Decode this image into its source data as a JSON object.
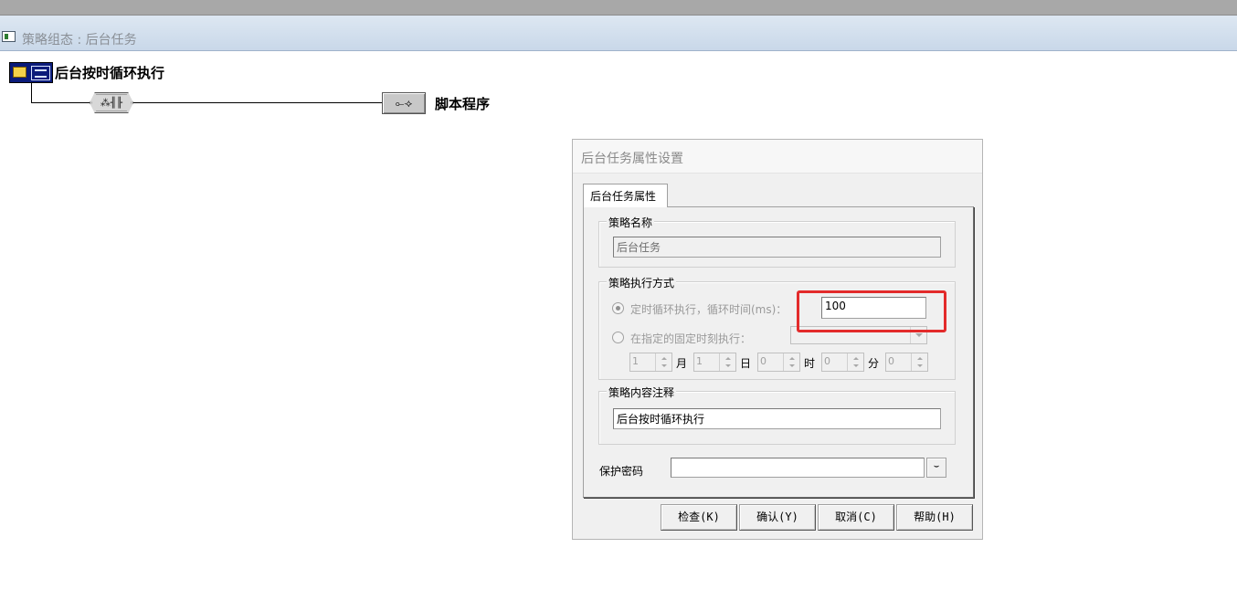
{
  "window": {
    "title": "策略组态 : 后台任务"
  },
  "tree": {
    "root_label": "后台按时循环执行",
    "condition_text": "⁂╢╟",
    "script_label": "脚本程序"
  },
  "dialog": {
    "title": "后台任务属性设置",
    "tab_label": "后台任务属性",
    "name_group": {
      "legend": "策略名称",
      "value": "后台任务"
    },
    "exec_group": {
      "legend": "策略执行方式",
      "option_timed_label": "定时循环执行，循环时间(ms)：",
      "option_timed_checked": true,
      "cycle_time_value": "100",
      "option_fixed_label": "在指定的固定时刻执行：",
      "option_fixed_checked": false,
      "fixed_time_selected": "",
      "month_value": "1",
      "month_unit": "月",
      "day_value": "1",
      "day_unit": "日",
      "hour_value": "0",
      "hour_unit": "时",
      "minute_value": "0",
      "minute_unit": "分",
      "second_value": "0"
    },
    "comment_group": {
      "legend": "策略内容注释",
      "value": "后台按时循环执行"
    },
    "password": {
      "label": "保护密码",
      "value": ""
    },
    "buttons": {
      "check": "检查(K)",
      "confirm": "确认(Y)",
      "cancel": "取消(C)",
      "help": "帮助(H)"
    }
  },
  "colors": {
    "highlight_box": "#e32b2b",
    "title_bar": "#c9d8e9"
  },
  "icons": [
    "window-icon",
    "folder-icon",
    "tree-icon",
    "condition-icon",
    "script-icon",
    "eye-icon"
  ]
}
